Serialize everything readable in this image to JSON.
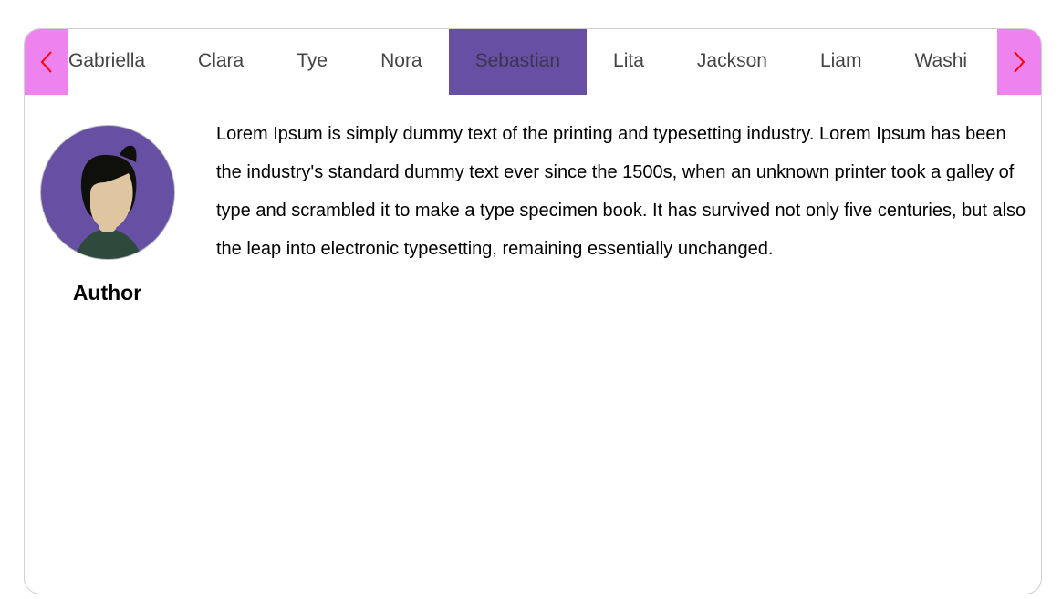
{
  "tabs": [
    {
      "label": "Gabriella"
    },
    {
      "label": "Clara"
    },
    {
      "label": "Tye"
    },
    {
      "label": "Nora"
    },
    {
      "label": "Sebastian",
      "selected": true
    },
    {
      "label": "Lita"
    },
    {
      "label": "Jackson"
    },
    {
      "label": "Liam"
    },
    {
      "label": "Washi"
    }
  ],
  "colors": {
    "selected_tab": "#6750A4",
    "arrow_bg": "#EE82EE",
    "arrow_glyph": "#FF0000"
  },
  "icons": {
    "left": "chevron-left-icon",
    "right": "chevron-right-icon",
    "avatar": "person-avatar"
  },
  "content": {
    "author_label": "Author",
    "text": "Lorem Ipsum is simply dummy text of the printing and typesetting industry. Lorem Ipsum has been the industry's standard dummy text ever since the 1500s, when an unknown printer took a galley of type and scrambled it to make a type specimen book. It has survived not only five centuries, but also the leap into electronic typesetting, remaining essentially unchanged."
  }
}
